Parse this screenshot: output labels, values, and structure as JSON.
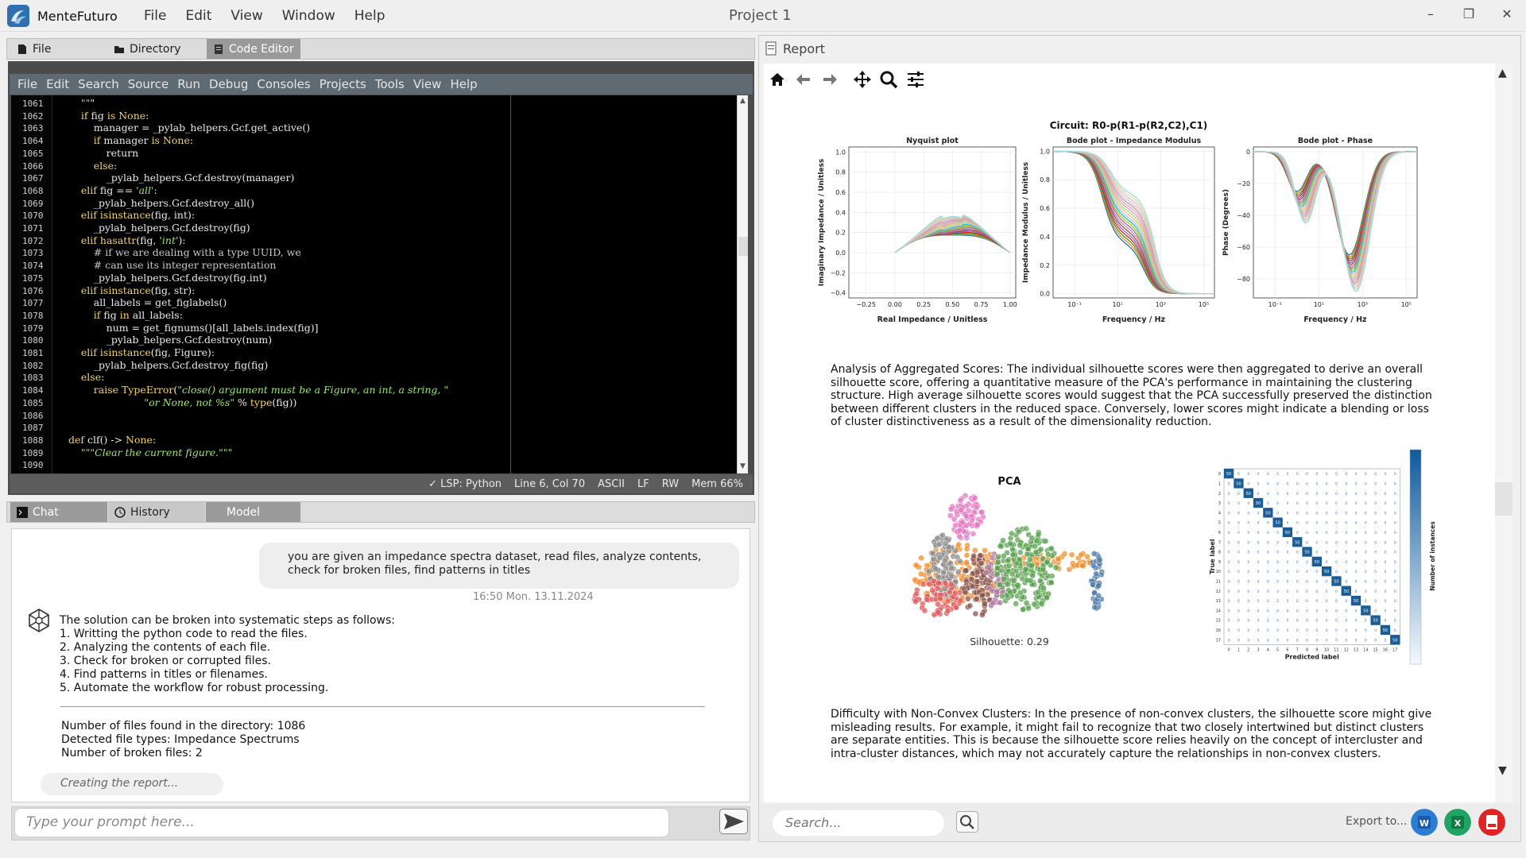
{
  "app": {
    "name": "MenteFuturo",
    "window_title": "Project 1",
    "menu": [
      "File",
      "Edit",
      "View",
      "Window",
      "Help"
    ],
    "window_controls": [
      "–",
      "❐",
      "✕"
    ]
  },
  "left_tabs": [
    "File",
    "Directory",
    "Code Editor"
  ],
  "editor": {
    "menu": [
      "File",
      "Edit",
      "Search",
      "Source",
      "Run",
      "Debug",
      "Consoles",
      "Projects",
      "Tools",
      "View",
      "Help"
    ],
    "line_numbers": [
      "1061",
      "1062",
      "1063",
      "1064",
      "1065",
      "1066",
      "1067",
      "1068",
      "1069",
      "1070",
      "1071",
      "1072",
      "1073",
      "1074",
      "1075",
      "1076",
      "1077",
      "1078",
      "1079",
      "1080",
      "1081",
      "1082",
      "1083",
      "1084",
      "1085",
      "1086",
      "1087",
      "1088",
      "1089",
      "1090"
    ],
    "lines": [
      "    \"\"\"",
      "    if fig is None:",
      "        manager = _pylab_helpers.Gcf.get_active()",
      "        if manager is None:",
      "            return",
      "        else:",
      "            _pylab_helpers.Gcf.destroy(manager)",
      "    elif fig == 'all':",
      "        _pylab_helpers.Gcf.destroy_all()",
      "    elif isinstance(fig, int):",
      "        _pylab_helpers.Gcf.destroy(fig)",
      "    elif hasattr(fig, 'int'):",
      "        # if we are dealing with a type UUID, we",
      "        # can use its integer representation",
      "        _pylab_helpers.Gcf.destroy(fig.int)",
      "    elif isinstance(fig, str):",
      "        all_labels = get_figlabels()",
      "        if fig in all_labels:",
      "            num = get_fignums()[all_labels.index(fig)]",
      "            _pylab_helpers.Gcf.destroy(num)",
      "    elif isinstance(fig, Figure):",
      "        _pylab_helpers.Gcf.destroy_fig(fig)",
      "    else:",
      "        raise TypeError(\"close() argument must be a Figure, an int, a string, \"",
      "                        \"or None, not %s\" % type(fig))",
      "",
      "",
      "def clf() -> None:",
      "    \"\"\"Clear the current figure.\"\"\""
    ],
    "status": [
      "✓ LSP: Python",
      "Line 6, Col 70",
      "ASCII",
      "LF",
      "RW",
      "Mem 66%"
    ]
  },
  "chat_tabs": [
    "Chat",
    "History",
    "Model"
  ],
  "chat": {
    "user_message": "you are given an impedance spectra dataset, read files, analyze contents, check for broken files, find patterns in titles",
    "timestamp": "16:50 Mon. 13.11.2024",
    "bot_lines": [
      "The solution can be broken into systematic steps as follows:",
      "1. Writting the python code to read the files.",
      "2. Analyzing the contents of each file.",
      "3. Check for broken or corrupted files.",
      "4. Find patterns in titles or filenames.",
      "5. Automate the workflow for robust processing."
    ],
    "stats": [
      "Number of files found in the directory: 1086",
      "Detected file types: Impedance Spectrums",
      "Number of broken files: 2"
    ],
    "status": "Creating the report...",
    "prompt_placeholder": "Type your prompt here..."
  },
  "report": {
    "title": "Report",
    "toolbar_icons": [
      "home-icon",
      "back-arrow-icon",
      "forward-arrow-icon",
      "pan-icon",
      "zoom-icon",
      "settings-sliders-icon"
    ],
    "circuit_title": "Circuit: R0-p(R1-p(R2,C2),C1)",
    "paragraph1": "Analysis of Aggregated Scores: The individual silhouette scores were then aggregated to derive an overall silhouette score, offering a quantitative measure of the PCA's performance in maintaining the clustering structure. High average silhouette scores would suggest that the PCA successfully preserved the distinction between different clusters in the reduced space. Conversely, lower scores might indicate a blending or loss of cluster distinctiveness as a result of the dimensionality reduction.",
    "paragraph2": "Difficulty with Non-Convex Clusters: In the presence of non-convex clusters, the silhouette score might give misleading results. For example, it might fail to recognize that two closely intertwined but distinct clusters are separate entities. This is because the silhouette score relies heavily on the concept of intercluster and intra-cluster distances, which may not accurately capture the relationships in non-convex clusters.",
    "search_placeholder": "Search...",
    "export_label": "Export to...",
    "export_buttons": [
      "word-export-icon",
      "excel-export-icon",
      "pdf-export-icon"
    ]
  },
  "chart_data": [
    {
      "type": "line",
      "title": "Nyquist plot",
      "xlabel": "Real Impedance / Unitless",
      "ylabel": "Imaginary Impedance / Unitless",
      "xticks": [
        "−0.25",
        "0.00",
        "0.25",
        "0.50",
        "0.75",
        "1.00"
      ],
      "yticks": [
        "1.0",
        "0.8",
        "0.6",
        "0.4",
        "0.2",
        "0.0",
        "−0.2",
        "−0.4"
      ],
      "xlim": [
        -0.4,
        1.05
      ],
      "ylim": [
        -0.45,
        1.05
      ],
      "series_count": 20,
      "arc_peak_range": [
        0.25,
        0.4
      ],
      "x_range": [
        0.0,
        1.0
      ]
    },
    {
      "type": "line",
      "title": "Bode plot - Impedance Modulus",
      "xlabel": "Frequency / Hz",
      "ylabel": "Impedance Modulus / Unitless",
      "xscale": "log",
      "xticks": [
        "10⁻¹",
        "10¹",
        "10³",
        "10⁵"
      ],
      "yticks": [
        "1.0",
        "0.8",
        "0.6",
        "0.4",
        "0.2",
        "0.0"
      ],
      "xlim": [
        -2,
        5.5
      ],
      "ylim": [
        -0.03,
        1.03
      ],
      "series_count": 20,
      "plateau_range": [
        0.35,
        0.7
      ]
    },
    {
      "type": "line",
      "title": "Bode plot - Phase",
      "xlabel": "Frequency / Hz",
      "ylabel": "Phase (Degrees)",
      "xscale": "log",
      "xticks": [
        "10⁻¹",
        "10¹",
        "10³",
        "10⁵"
      ],
      "yticks": [
        "0",
        "−20",
        "−40",
        "−60",
        "−80"
      ],
      "xlim": [
        -2,
        5.5
      ],
      "ylim": [
        -92,
        3
      ],
      "series_count": 20,
      "first_min_range": [
        -25,
        -45
      ],
      "second_min_range": [
        -65,
        -88
      ]
    },
    {
      "type": "scatter",
      "title": "PCA",
      "annotation": "Silhouette: 0.29",
      "cluster_colors": [
        "#f28e2b",
        "#e377c2",
        "#8c8c8c",
        "#e15759",
        "#8c564b",
        "#59a14f",
        "#4e79a7",
        "#b07aa1"
      ]
    },
    {
      "type": "heatmap",
      "xlabel": "Predicted label",
      "ylabel": "True label",
      "colorbar_label": "Number of instances",
      "matrix_size": 18,
      "diagonal_value": "50",
      "off_diagonal_value": "0"
    }
  ]
}
